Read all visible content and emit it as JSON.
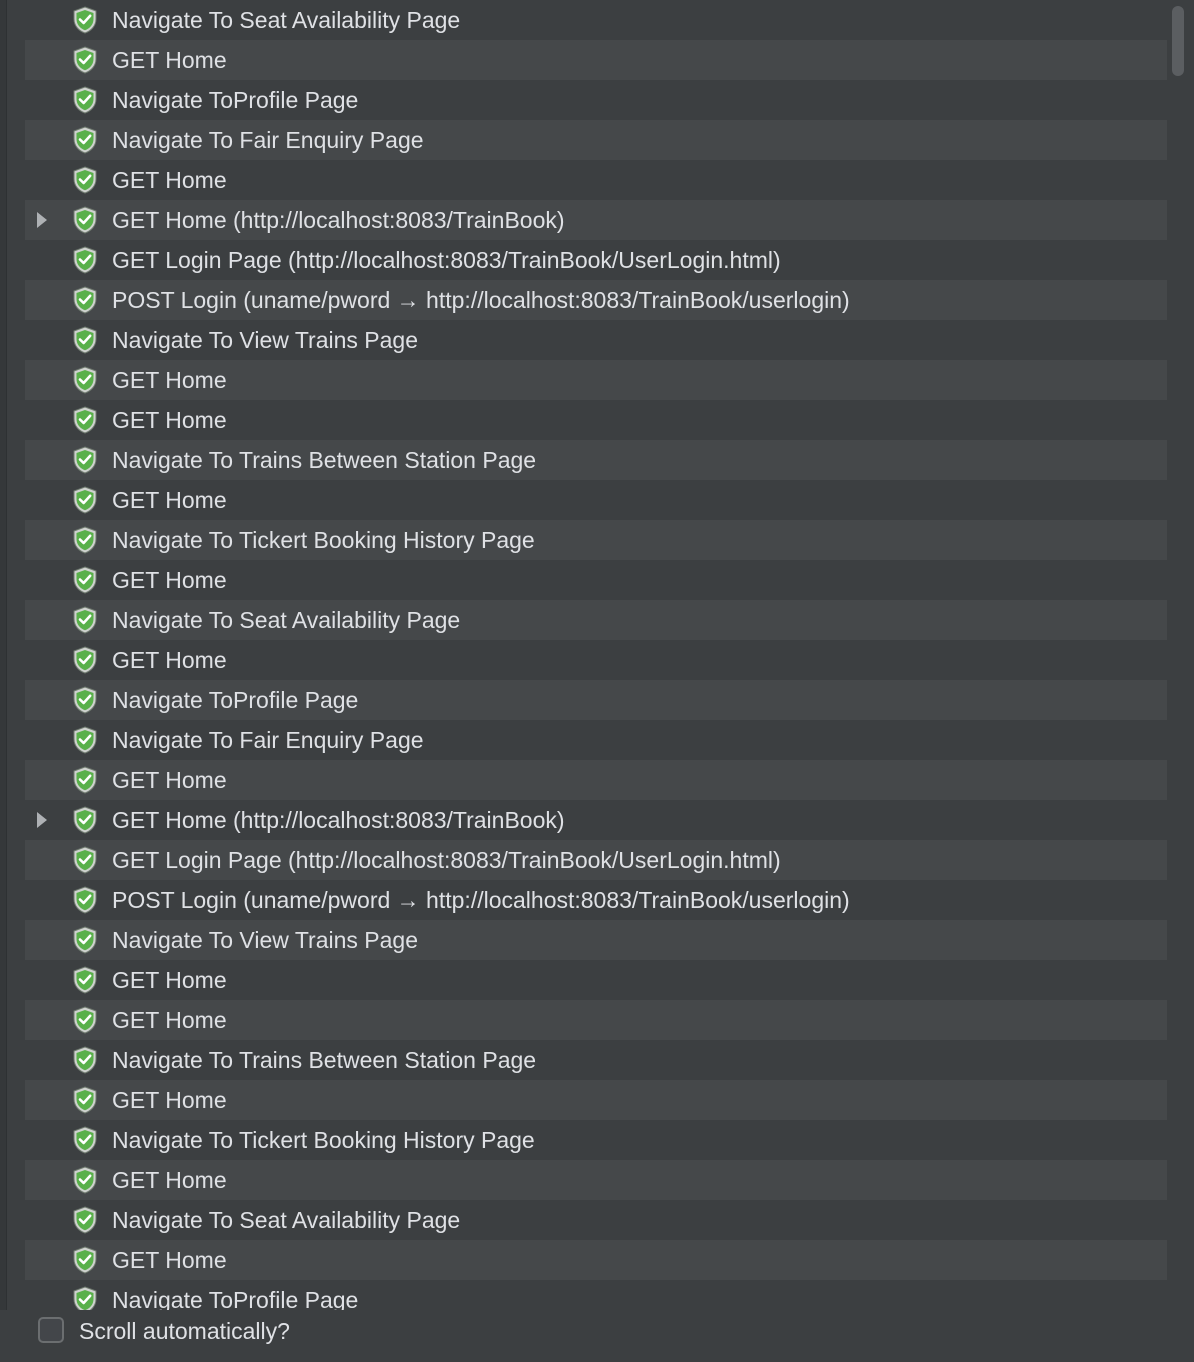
{
  "colors": {
    "background": "#3c3f41",
    "row_alt": "#45484a",
    "text": "#dfe1e5",
    "shield_green": "#59b04a"
  },
  "tree": {
    "items": [
      {
        "label": "Navigate To Seat Availability Page",
        "icon": "shield-check-icon",
        "expandable": false
      },
      {
        "label": "GET Home",
        "icon": "shield-check-icon",
        "expandable": false
      },
      {
        "label": "Navigate ToProfile Page",
        "icon": "shield-check-icon",
        "expandable": false
      },
      {
        "label": "Navigate To Fair Enquiry Page",
        "icon": "shield-check-icon",
        "expandable": false
      },
      {
        "label": "GET Home",
        "icon": "shield-check-icon",
        "expandable": false
      },
      {
        "label": "GET Home (http://localhost:8083/TrainBook)",
        "icon": "shield-check-icon",
        "expandable": true
      },
      {
        "label": "GET Login Page (http://localhost:8083/TrainBook/UserLogin.html)",
        "icon": "shield-check-icon",
        "expandable": false
      },
      {
        "label": "POST Login (uname/pword → http://localhost:8083/TrainBook/userlogin)",
        "icon": "shield-check-icon",
        "expandable": false
      },
      {
        "label": "Navigate To View Trains Page",
        "icon": "shield-check-icon",
        "expandable": false
      },
      {
        "label": "GET Home",
        "icon": "shield-check-icon",
        "expandable": false
      },
      {
        "label": "GET Home",
        "icon": "shield-check-icon",
        "expandable": false
      },
      {
        "label": "Navigate To Trains Between Station Page",
        "icon": "shield-check-icon",
        "expandable": false
      },
      {
        "label": "GET Home",
        "icon": "shield-check-icon",
        "expandable": false
      },
      {
        "label": "Navigate To Tickert Booking History Page",
        "icon": "shield-check-icon",
        "expandable": false
      },
      {
        "label": "GET Home",
        "icon": "shield-check-icon",
        "expandable": false
      },
      {
        "label": "Navigate To Seat Availability Page",
        "icon": "shield-check-icon",
        "expandable": false
      },
      {
        "label": "GET Home",
        "icon": "shield-check-icon",
        "expandable": false
      },
      {
        "label": "Navigate ToProfile Page",
        "icon": "shield-check-icon",
        "expandable": false
      },
      {
        "label": "Navigate To Fair Enquiry Page",
        "icon": "shield-check-icon",
        "expandable": false
      },
      {
        "label": "GET Home",
        "icon": "shield-check-icon",
        "expandable": false
      },
      {
        "label": "GET Home (http://localhost:8083/TrainBook)",
        "icon": "shield-check-icon",
        "expandable": true
      },
      {
        "label": "GET Login Page (http://localhost:8083/TrainBook/UserLogin.html)",
        "icon": "shield-check-icon",
        "expandable": false
      },
      {
        "label": "POST Login (uname/pword → http://localhost:8083/TrainBook/userlogin)",
        "icon": "shield-check-icon",
        "expandable": false
      },
      {
        "label": "Navigate To View Trains Page",
        "icon": "shield-check-icon",
        "expandable": false
      },
      {
        "label": "GET Home",
        "icon": "shield-check-icon",
        "expandable": false
      },
      {
        "label": "GET Home",
        "icon": "shield-check-icon",
        "expandable": false
      },
      {
        "label": "Navigate To Trains Between Station Page",
        "icon": "shield-check-icon",
        "expandable": false
      },
      {
        "label": "GET Home",
        "icon": "shield-check-icon",
        "expandable": false
      },
      {
        "label": "Navigate To Tickert Booking History Page",
        "icon": "shield-check-icon",
        "expandable": false
      },
      {
        "label": "GET Home",
        "icon": "shield-check-icon",
        "expandable": false
      },
      {
        "label": "Navigate To Seat Availability Page",
        "icon": "shield-check-icon",
        "expandable": false
      },
      {
        "label": "GET Home",
        "icon": "shield-check-icon",
        "expandable": false
      },
      {
        "label": "Navigate ToProfile Page",
        "icon": "shield-check-icon",
        "expandable": false
      }
    ]
  },
  "footer": {
    "scroll_checkbox_label": "Scroll automatically?",
    "scroll_checkbox_checked": false
  }
}
